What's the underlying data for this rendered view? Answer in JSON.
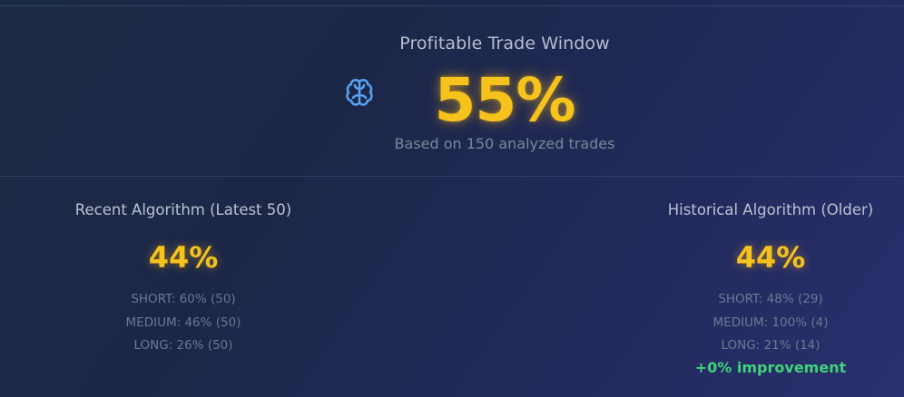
{
  "hero": {
    "title": "Profitable Trade Window",
    "value": "55%",
    "subtitle": "Based on 150 analyzed trades",
    "icon": "brain-icon",
    "value_color": "#f6c21c"
  },
  "recent": {
    "title": "Recent Algorithm (Latest 50)",
    "value": "44%",
    "rows": [
      "SHORT: 60% (50)",
      "MEDIUM: 46% (50)",
      "LONG: 26% (50)"
    ]
  },
  "historical": {
    "title": "Historical Algorithm (Older)",
    "value": "44%",
    "rows": [
      "SHORT: 48% (29)",
      "MEDIUM: 100% (4)",
      "LONG: 21% (14)"
    ]
  },
  "improvement": {
    "text": "+0% improvement",
    "color": "#3fd47a"
  },
  "colors": {
    "accent_yellow": "#f6c21c",
    "icon_blue": "#5aa0f0",
    "positive_green": "#3fd47a"
  }
}
